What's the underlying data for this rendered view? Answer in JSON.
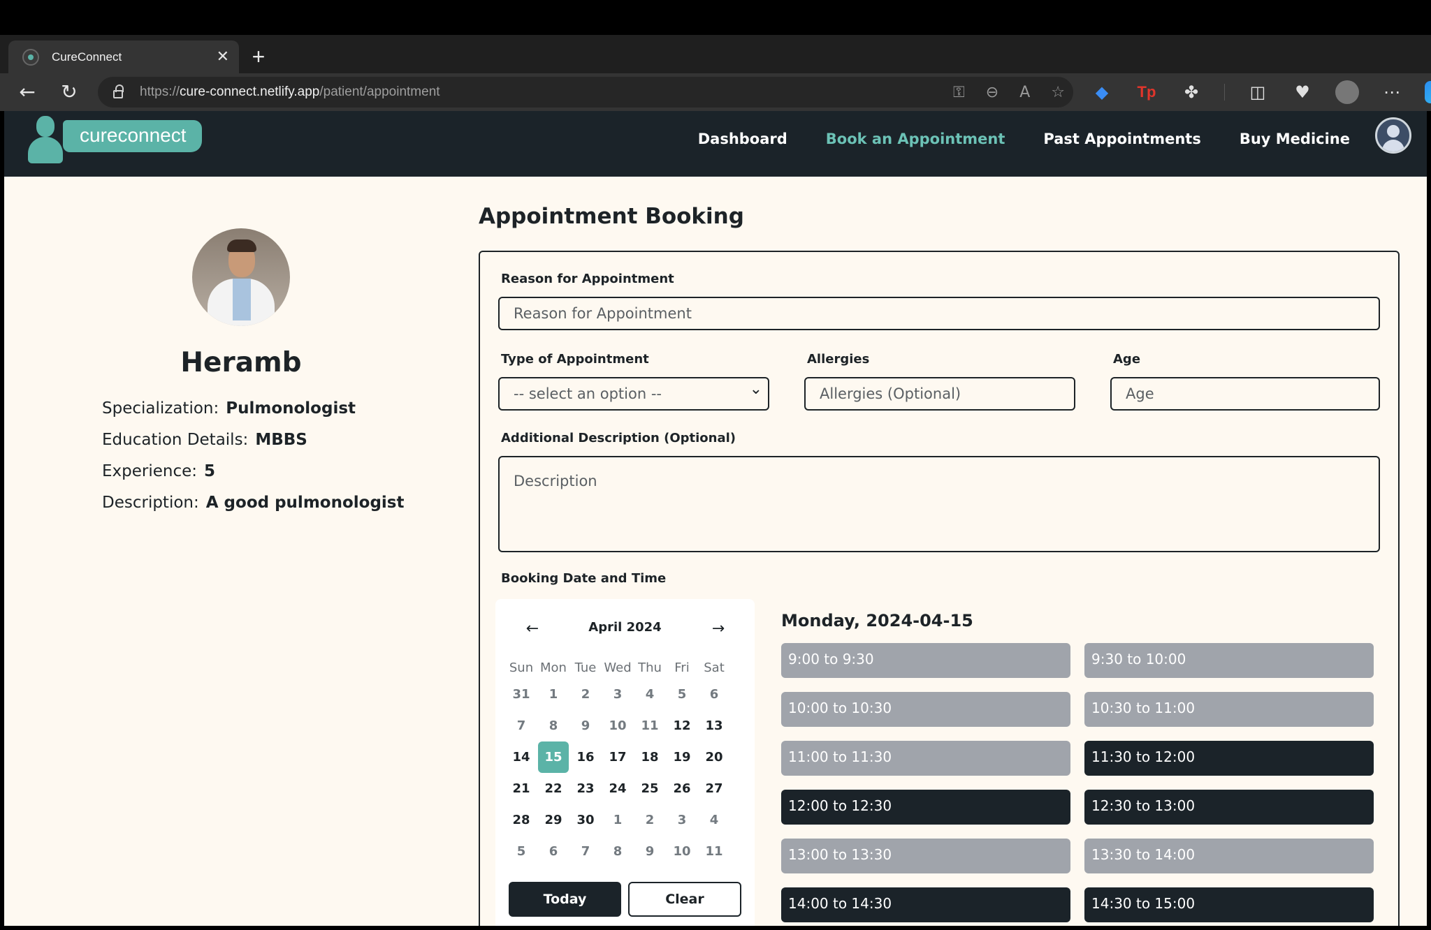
{
  "browser": {
    "tab_title": "CureConnect",
    "url_prefix": "https://",
    "url_host": "cure-connect.netlify.app",
    "url_path": "/patient/appointment"
  },
  "nav": {
    "brand": "cureconnect",
    "links": [
      "Dashboard",
      "Book an Appointment",
      "Past Appointments",
      "Buy Medicine"
    ],
    "active_link": "Book an Appointment"
  },
  "doctor": {
    "name": "Heramb",
    "specialization_label": "Specialization:",
    "specialization": "Pulmonologist",
    "education_label": "Education Details:",
    "education": "MBBS",
    "experience_label": "Experience:",
    "experience": "5",
    "description_label": "Description:",
    "description": "A good pulmonologist"
  },
  "form": {
    "title": "Appointment Booking",
    "reason_label": "Reason for Appointment",
    "reason_placeholder": "Reason for Appointment",
    "type_label": "Type of Appointment",
    "type_value": "-- select an option --",
    "allergies_label": "Allergies",
    "allergies_placeholder": "Allergies (Optional)",
    "age_label": "Age",
    "age_placeholder": "Age",
    "desc_label": "Additional Description (Optional)",
    "desc_placeholder": "Description",
    "datetime_label": "Booking Date and Time"
  },
  "calendar": {
    "month": "April 2024",
    "weekdays": [
      "Sun",
      "Mon",
      "Tue",
      "Wed",
      "Thu",
      "Fri",
      "Sat"
    ],
    "weeks": [
      [
        "31",
        "1",
        "2",
        "3",
        "4",
        "5",
        "6"
      ],
      [
        "7",
        "8",
        "9",
        "10",
        "11",
        "12",
        "13"
      ],
      [
        "14",
        "15",
        "16",
        "17",
        "18",
        "19",
        "20"
      ],
      [
        "21",
        "22",
        "23",
        "24",
        "25",
        "26",
        "27"
      ],
      [
        "28",
        "29",
        "30",
        "1",
        "2",
        "3",
        "4"
      ],
      [
        "5",
        "6",
        "7",
        "8",
        "9",
        "10",
        "11"
      ]
    ],
    "selected_day": "15",
    "today_label": "Today",
    "clear_label": "Clear"
  },
  "slots": {
    "date_heading": "Monday, 2024-04-15",
    "items": [
      {
        "label": "9:00 to 9:30",
        "available": false
      },
      {
        "label": "9:30 to 10:00",
        "available": false
      },
      {
        "label": "10:00 to 10:30",
        "available": false
      },
      {
        "label": "10:30 to 11:00",
        "available": false
      },
      {
        "label": "11:00 to 11:30",
        "available": false
      },
      {
        "label": "11:30 to 12:00",
        "available": true
      },
      {
        "label": "12:00 to 12:30",
        "available": true
      },
      {
        "label": "12:30 to 13:00",
        "available": true
      },
      {
        "label": "13:00 to 13:30",
        "available": false
      },
      {
        "label": "13:30 to 14:00",
        "available": false
      },
      {
        "label": "14:00 to 14:30",
        "available": true
      },
      {
        "label": "14:30 to 15:00",
        "available": true
      }
    ]
  },
  "colors": {
    "accent": "#5bb3a7",
    "nav_bg": "#1b2329",
    "page_bg": "#fef9f1",
    "slot_unavailable": "#a0a4ab"
  }
}
